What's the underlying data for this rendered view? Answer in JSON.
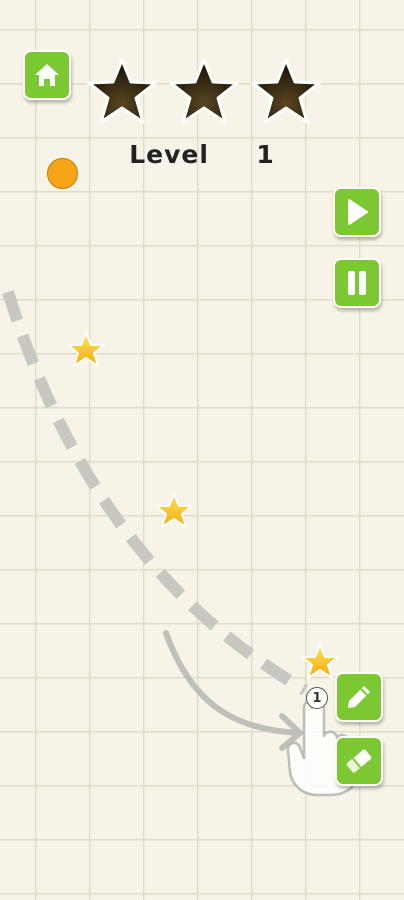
{
  "level": {
    "title": "Level  1",
    "current": 1
  },
  "rating": {
    "stars_earned": 0,
    "stars_total": 3
  },
  "buttons": {
    "home": "home-icon",
    "play": "play-icon",
    "pause": "pause-icon",
    "pencil": "pencil-icon",
    "eraser": "eraser-icon"
  },
  "tutorial": {
    "step": "1"
  },
  "colors": {
    "button_green": "#7cc832",
    "ball": "#f7a516",
    "star_gold": "#f5c518",
    "empty_star": "#3b2d12",
    "paper": "#f7f3e6",
    "hint_path": "#c8c8c2"
  }
}
